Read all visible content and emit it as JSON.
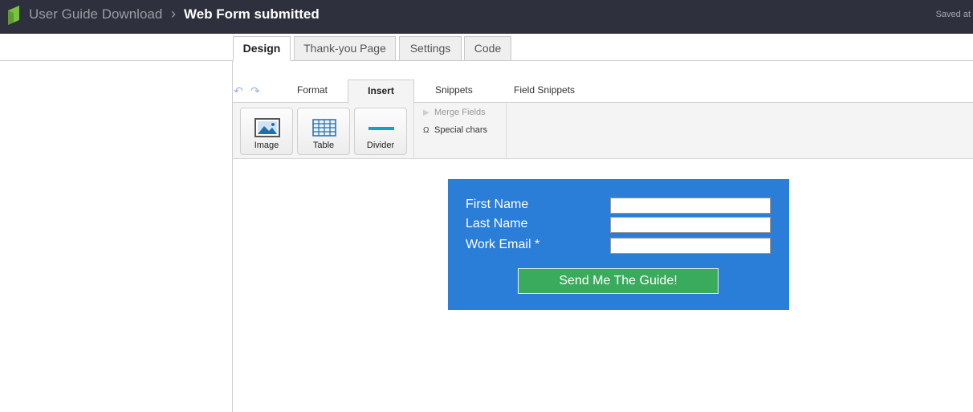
{
  "header": {
    "parent_title": "User Guide Download",
    "separator": "›",
    "current_title": "Web Form submitted",
    "saved_text": "Saved at"
  },
  "main_tabs": [
    {
      "label": "Design",
      "active": true
    },
    {
      "label": "Thank-you Page",
      "active": false
    },
    {
      "label": "Settings",
      "active": false
    },
    {
      "label": "Code",
      "active": false
    }
  ],
  "ribbon": {
    "tabs": {
      "format": "Format",
      "insert": "Insert",
      "snippets": "Snippets",
      "field_snippets": "Field Snippets"
    },
    "buttons": {
      "image": "Image",
      "table": "Table",
      "divider": "Divider"
    },
    "merge_fields": "Merge Fields",
    "special_chars_icon": "Ω",
    "special_chars": "Special chars"
  },
  "form": {
    "fields": [
      {
        "label": "First Name",
        "value": ""
      },
      {
        "label": "Last Name",
        "value": ""
      },
      {
        "label": "Work Email *",
        "value": ""
      }
    ],
    "submit_label": "Send Me The Guide!",
    "background_color": "#2a7ed8",
    "button_color": "#3aab5d"
  },
  "colors": {
    "topbar": "#2e313d",
    "logo_green": "#7bc142"
  }
}
